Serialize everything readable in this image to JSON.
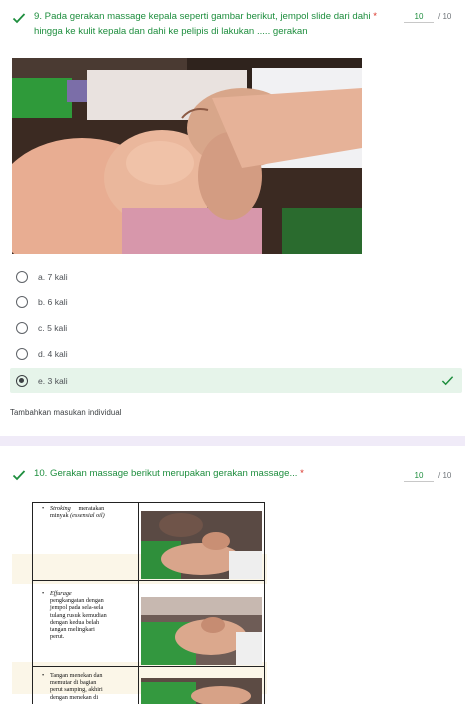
{
  "question1": {
    "number_text": "9. Pada gerakan massage kepala seperti gambar berikut, jempol slide dari dahi",
    "required_mark": "*",
    "title_line2": "hingga ke kulit kepala dan dahi ke pelipis di lakukan ..... gerakan",
    "score": "10",
    "total": "/ 10",
    "options": [
      {
        "label": "a. 7 kali",
        "selected": false
      },
      {
        "label": "b. 6 kali",
        "selected": false
      },
      {
        "label": "c. 5 kali",
        "selected": false
      },
      {
        "label": "d. 4 kali",
        "selected": false
      },
      {
        "label": "e. 3 kali",
        "selected": true,
        "correct": true
      }
    ],
    "feedback_label": "Tambahkan masukan individual"
  },
  "question2": {
    "title": "10.  Gerakan massage berikut merupakan gerakan massage...",
    "required_mark": "*",
    "score": "10",
    "total": "/ 10",
    "table_rows": [
      {
        "bullet": "•",
        "term": "Stroking",
        "text_a": "meratakan",
        "text_b": "minyak",
        "text_c": "(essensial oil)"
      },
      {
        "bullet": "•",
        "term": "Effurage",
        "lines": [
          "pengkangatan dengan",
          "jempol pada sela-sela",
          "tulang rusuk kemudian",
          "dengan  kedua  belah",
          "tangan         melingkari",
          "perut."
        ]
      },
      {
        "bullet": "•",
        "lines": [
          "Tangan  menekan  dan",
          "memutar   di   bagian",
          "perut  samping,  akhiri",
          "dengan   menekan   di"
        ]
      }
    ]
  },
  "colors": {
    "correct_green": "#1e8e3e",
    "correct_bg": "#e6f4ea",
    "required_red": "#d93025",
    "section_divider": "#f0ebf8"
  },
  "icons": {
    "question_check": "check-icon",
    "option_correct": "check-icon"
  }
}
